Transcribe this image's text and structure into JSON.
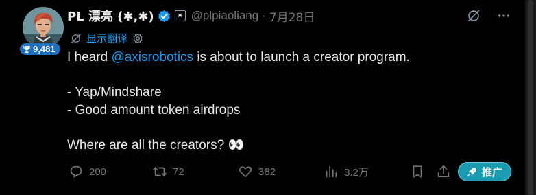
{
  "author": {
    "display_name": "PL 漂亮 (✱,✱)",
    "handle": "@plpiaoliang",
    "separator": "·",
    "date": "7月28日",
    "score_badge": "9,481",
    "affiliate_glyph": "✷"
  },
  "translate": {
    "label": "显示翻译"
  },
  "tweet": {
    "line1_before": "I heard ",
    "line1_mention": "@axisrobotics",
    "line1_after": " is about to launch a creator program.",
    "line2": "- Yap/Mindshare",
    "line3": "- Good amount token airdrops",
    "line4": "Where are all the creators? 👀"
  },
  "actions": {
    "replies": "200",
    "retweets": "72",
    "likes": "382",
    "views": "3.2万",
    "promote_label": "推广"
  },
  "colors": {
    "background": "#000000",
    "text": "#e7e9ea",
    "muted": "#71767b",
    "link": "#1d9bf0",
    "promote": "#1b9bb2",
    "verified": "#1d9bf0"
  }
}
